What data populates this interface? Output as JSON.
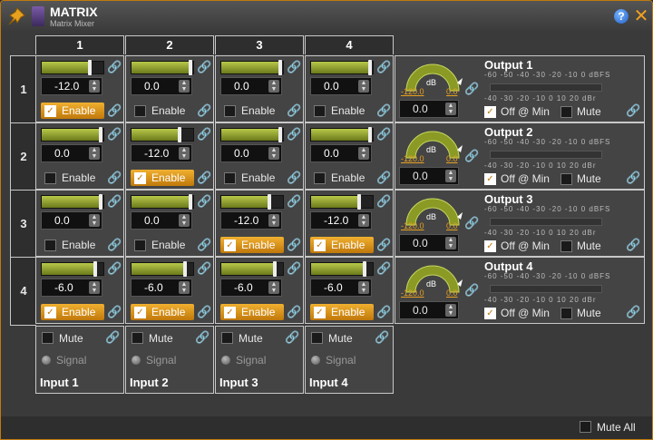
{
  "window": {
    "title": "MATRIX",
    "subtitle": "Matrix Mixer"
  },
  "colors": {
    "accent": "#d8901a",
    "fader": "#9aaa2a"
  },
  "columns": [
    "1",
    "2",
    "3",
    "4"
  ],
  "rows": [
    "1",
    "2",
    "3",
    "4"
  ],
  "enable_label": "Enable",
  "crosspoints": [
    [
      {
        "value": "-12.0",
        "level": 0.8,
        "enabled": true
      },
      {
        "value": "0.0",
        "level": 0.98,
        "enabled": false
      },
      {
        "value": "0.0",
        "level": 0.98,
        "enabled": false
      },
      {
        "value": "0.0",
        "level": 0.98,
        "enabled": false
      }
    ],
    [
      {
        "value": "0.0",
        "level": 0.98,
        "enabled": false
      },
      {
        "value": "-12.0",
        "level": 0.8,
        "enabled": true
      },
      {
        "value": "0.0",
        "level": 0.98,
        "enabled": false
      },
      {
        "value": "0.0",
        "level": 0.98,
        "enabled": false
      }
    ],
    [
      {
        "value": "0.0",
        "level": 0.98,
        "enabled": false
      },
      {
        "value": "0.0",
        "level": 0.98,
        "enabled": false
      },
      {
        "value": "-12.0",
        "level": 0.8,
        "enabled": true
      },
      {
        "value": "-12.0",
        "level": 0.8,
        "enabled": true
      }
    ],
    [
      {
        "value": "-6.0",
        "level": 0.9,
        "enabled": true
      },
      {
        "value": "-6.0",
        "level": 0.9,
        "enabled": true
      },
      {
        "value": "-6.0",
        "level": 0.9,
        "enabled": true
      },
      {
        "value": "-6.0",
        "level": 0.9,
        "enabled": true
      }
    ]
  ],
  "outputs": [
    {
      "name": "Output 1",
      "value": "0.0",
      "meter_min": "-120.0",
      "meter_max": "0.0",
      "meter_unit": "dB",
      "off_at_min": true
    },
    {
      "name": "Output 2",
      "value": "0.0",
      "meter_min": "-120.0",
      "meter_max": "0.0",
      "meter_unit": "dB",
      "off_at_min": true
    },
    {
      "name": "Output 3",
      "value": "0.0",
      "meter_min": "-120.0",
      "meter_max": "0.0",
      "meter_unit": "dB",
      "off_at_min": true
    },
    {
      "name": "Output 4",
      "value": "0.0",
      "meter_min": "-120.0",
      "meter_max": "0.0",
      "meter_unit": "dB",
      "off_at_min": true
    }
  ],
  "output_labels": {
    "off_at_min": "Off @ Min",
    "mute": "Mute"
  },
  "scales": {
    "dbfs": "-60  -50  -40  -30  -20  -10   0 dBFS",
    "dbr": "-40  -30  -20  -10    0   10   20 dBr"
  },
  "inputs": [
    {
      "name": "Input 1",
      "mute": "Mute",
      "signal": "Signal"
    },
    {
      "name": "Input 2",
      "mute": "Mute",
      "signal": "Signal"
    },
    {
      "name": "Input 3",
      "mute": "Mute",
      "signal": "Signal"
    },
    {
      "name": "Input 4",
      "mute": "Mute",
      "signal": "Signal"
    }
  ],
  "footer": {
    "mute_all": "Mute All"
  }
}
